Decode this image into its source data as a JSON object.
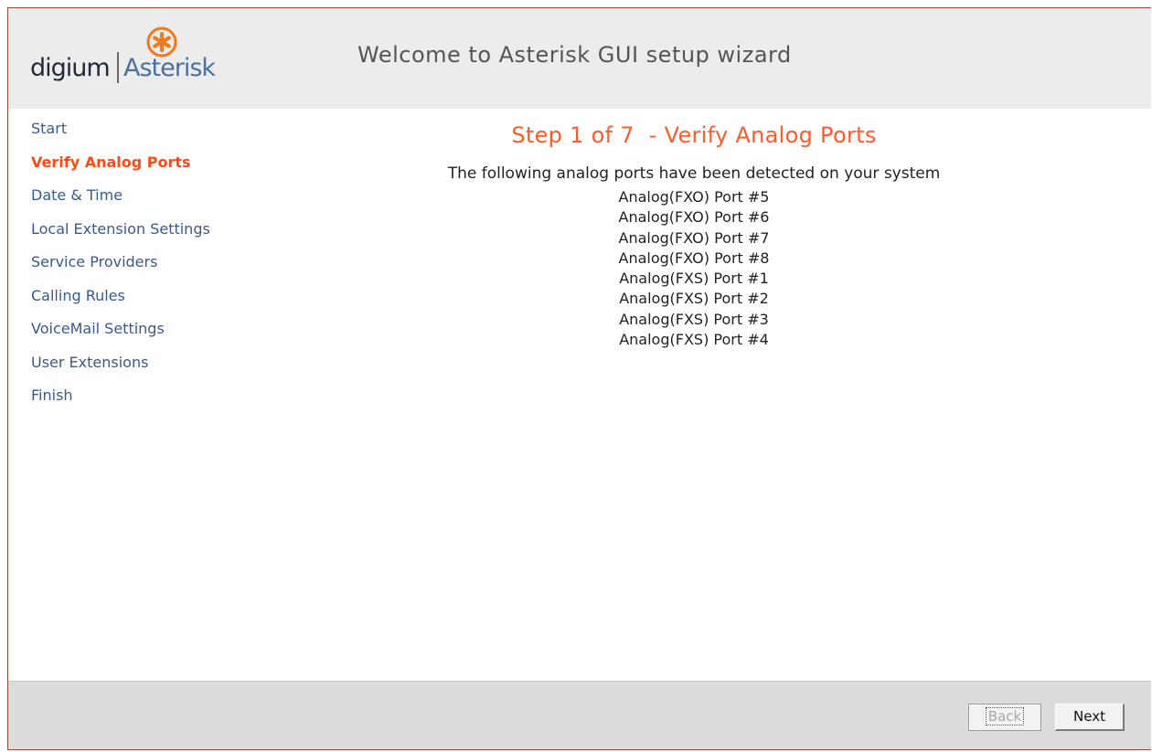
{
  "header": {
    "logo_digium": "digium",
    "logo_asterisk": "Asterisk",
    "title": "Welcome to Asterisk GUI setup wizard"
  },
  "sidebar": {
    "items": [
      {
        "label": "Start",
        "active": false
      },
      {
        "label": "Verify Analog Ports",
        "active": true
      },
      {
        "label": "Date & Time",
        "active": false
      },
      {
        "label": "Local Extension Settings",
        "active": false
      },
      {
        "label": "Service Providers",
        "active": false
      },
      {
        "label": "Calling Rules",
        "active": false
      },
      {
        "label": "VoiceMail Settings",
        "active": false
      },
      {
        "label": "User Extensions",
        "active": false
      },
      {
        "label": "Finish",
        "active": false
      }
    ]
  },
  "main": {
    "step_title": "Step 1 of 7  - Verify Analog Ports",
    "intro": "The following analog ports have been detected on your system",
    "ports": [
      "Analog(FXO) Port #5",
      "Analog(FXO) Port #6",
      "Analog(FXO) Port #7",
      "Analog(FXO) Port #8",
      "Analog(FXS) Port #1",
      "Analog(FXS) Port #2",
      "Analog(FXS) Port #3",
      "Analog(FXS) Port #4"
    ]
  },
  "footer": {
    "back_label": "Back",
    "next_label": "Next"
  },
  "colors": {
    "accent": "#ff4a14",
    "nav_link": "#3a5a8a",
    "header_bg": "#ececec",
    "footer_bg": "#dcdcdc"
  }
}
